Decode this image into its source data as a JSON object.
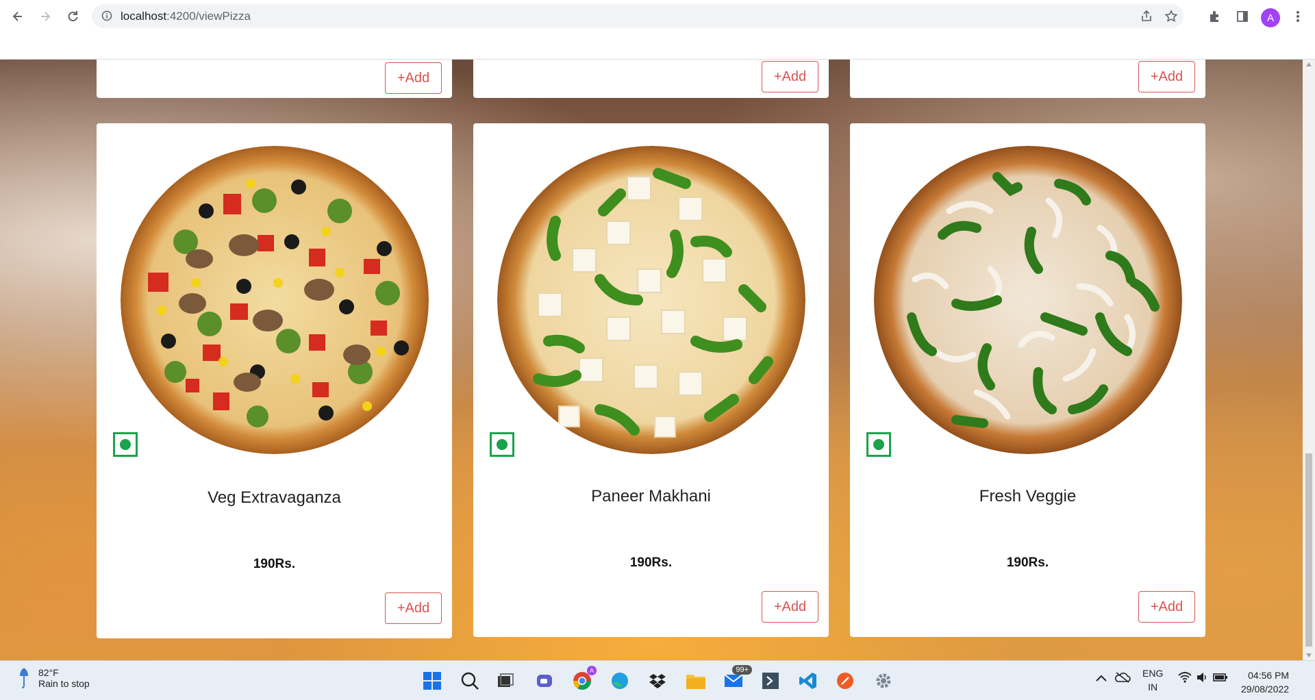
{
  "browser": {
    "url_host": "localhost",
    "url_path": ":4200/viewPizza",
    "profile_initial": "A"
  },
  "top_row": [
    {
      "add_label": "+Add"
    },
    {
      "add_label": "+Add"
    },
    {
      "add_label": "+Add"
    }
  ],
  "pizzas": [
    {
      "name": "Veg Extravaganza",
      "price": "190Rs.",
      "add_label": "+Add"
    },
    {
      "name": "Paneer Makhani",
      "price": "190Rs.",
      "add_label": "+Add"
    },
    {
      "name": "Fresh Veggie",
      "price": "190Rs.",
      "add_label": "+Add"
    }
  ],
  "taskbar": {
    "weather_temp": "82°F",
    "weather_cond": "Rain to stop",
    "mail_badge": "99+",
    "lang_top": "ENG",
    "lang_bottom": "IN",
    "time": "04:56 PM",
    "date": "29/08/2022"
  },
  "colors": {
    "accent": "#d9534f",
    "veg_green": "#1aa34a",
    "profile": "#a142f4"
  }
}
